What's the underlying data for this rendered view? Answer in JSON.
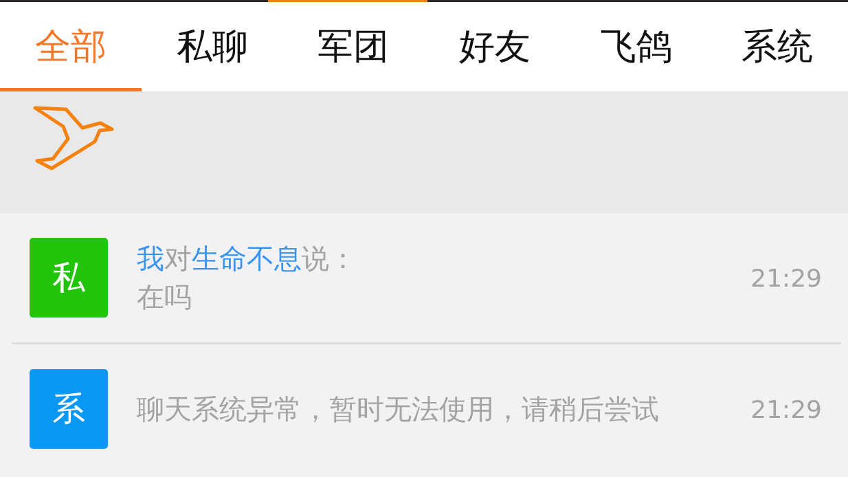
{
  "tabs": [
    {
      "label": "全部",
      "selected": true
    },
    {
      "label": "私聊",
      "selected": false
    },
    {
      "label": "军团",
      "selected": false
    },
    {
      "label": "好友",
      "selected": false
    },
    {
      "label": "飞鸽",
      "selected": false
    },
    {
      "label": "系统",
      "selected": false
    }
  ],
  "messages": [
    {
      "badge": "私",
      "color": "#22c40a",
      "header": [
        {
          "text": "我",
          "highlight": true
        },
        {
          "text": "对",
          "highlight": false
        },
        {
          "text": "生命不息",
          "highlight": true
        },
        {
          "text": "说：",
          "highlight": false
        }
      ],
      "body": "在吗",
      "time": "21:29"
    },
    {
      "badge": "系",
      "color": "#0b98f5",
      "body": "聊天系统异常，暂时无法使用，请稍后尝试",
      "time": "21:29"
    }
  ]
}
